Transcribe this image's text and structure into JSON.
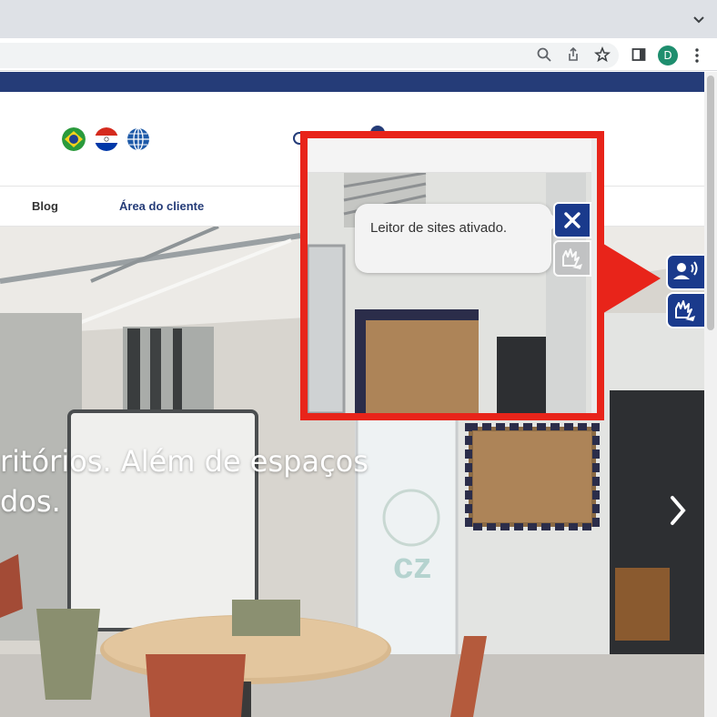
{
  "browser": {
    "profile_initial": "D",
    "icons": [
      "search-icon",
      "share-icon",
      "star-icon",
      "side-panel-icon",
      "kebab-menu-icon",
      "chevron-down-icon"
    ]
  },
  "header": {
    "flags": [
      "brazil-flag",
      "paraguay-flag",
      "globe-icon"
    ]
  },
  "nav": {
    "blog_label": "Blog",
    "client_area_label": "Área do cliente"
  },
  "hero": {
    "line1": "ritórios. Além de espaços",
    "line2": "dos."
  },
  "accessibility": {
    "reader_tooltip": "Leitor de sites ativado.",
    "accent_color": "#1a3a8c"
  },
  "callout": {
    "color": "#e8241a"
  }
}
